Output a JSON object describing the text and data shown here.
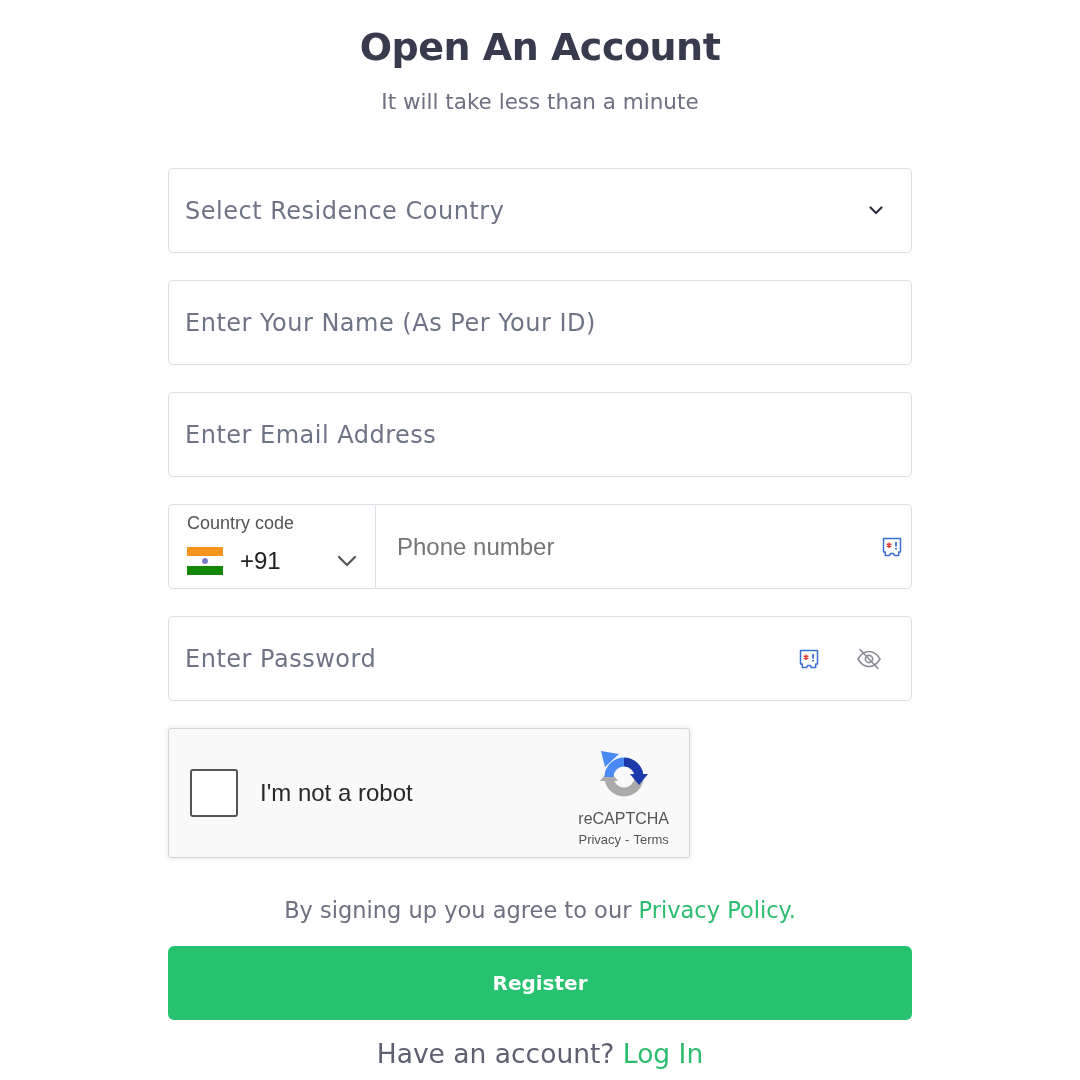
{
  "header": {
    "title": "Open An Account",
    "subtitle": "It will take less than a minute"
  },
  "fields": [
    {
      "kind": "select",
      "placeholder": "Select Residence Country"
    },
    {
      "kind": "text",
      "placeholder": "Enter Your Name (As Per Your ID)"
    },
    {
      "kind": "email",
      "placeholder": "Enter Email Address"
    },
    {
      "kind": "phone",
      "country_code_label": "Country code",
      "country_code": "+91",
      "placeholder": "Phone number"
    },
    {
      "kind": "password",
      "placeholder": "Enter Password"
    }
  ],
  "captcha": {
    "label": "I'm not a robot",
    "checked": false,
    "brand": "reCAPTCHA",
    "links": [
      "Privacy",
      "Terms"
    ],
    "separator": "-"
  },
  "agreement": {
    "text": "By signing up you agree to our",
    "link": "Privacy Policy."
  },
  "register_button": "Register",
  "login_prompt": {
    "text": "Have an account?",
    "link": "Log In"
  }
}
